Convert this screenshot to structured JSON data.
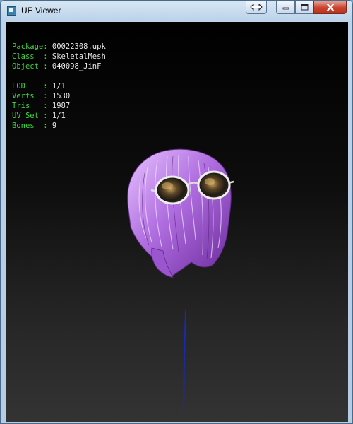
{
  "window": {
    "title": "UE Viewer",
    "controls": {
      "swap_icon": "swap-arrows-icon",
      "minimize_icon": "minimize-icon",
      "maximize_icon": "maximize-icon",
      "close_icon": "close-icon"
    }
  },
  "info_panel": {
    "package_label": "Package:",
    "package_value": "00022308.upk",
    "class_label": "Class  :",
    "class_value": "SkeletalMesh",
    "object_label": "Object :",
    "object_value": "040098_JinF",
    "lod_label": "LOD    :",
    "lod_value": "1/1",
    "verts_label": "Verts  :",
    "verts_value": "1530",
    "tris_label": "Tris   :",
    "tris_value": "1987",
    "uvset_label": "UV Set :",
    "uvset_value": "1/1",
    "bones_label": "Bones  :",
    "bones_value": "9"
  },
  "colors": {
    "label_green": "#3fd13f",
    "value_white": "#e8e8e8",
    "hair_purple": "#b97ae0",
    "bone_line": "#1a2aa8"
  }
}
